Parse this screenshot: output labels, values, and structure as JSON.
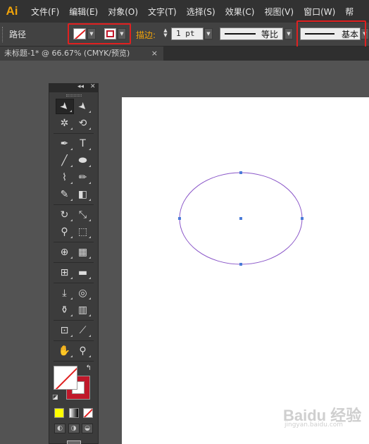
{
  "app": {
    "logo": "Ai"
  },
  "menu": [
    "文件(F)",
    "编辑(E)",
    "对象(O)",
    "文字(T)",
    "选择(S)",
    "效果(C)",
    "视图(V)",
    "窗口(W)",
    "帮"
  ],
  "control_bar": {
    "selection_label": "路径",
    "fill": "none",
    "stroke_color": "#c0182a",
    "stroke_label": "描边:",
    "stroke_weight": "1 pt",
    "variable_width_profile": "等比",
    "brush_definition": "基本"
  },
  "document_tab": {
    "title": "未标题-1* @ 66.67% (CMYK/预览)",
    "close": "×"
  },
  "tool_panel": {
    "collapse_glyph": "◂◂",
    "close_glyph": "✕",
    "rows": [
      [
        {
          "name": "selection-tool-icon",
          "glyph": "➤",
          "active": true
        },
        {
          "name": "direct-selection-tool-icon",
          "glyph": "➤"
        }
      ],
      [
        {
          "name": "magic-wand-tool-icon",
          "glyph": "✲"
        },
        {
          "name": "lasso-tool-icon",
          "glyph": "⟲"
        }
      ],
      [
        {
          "name": "pen-tool-icon",
          "glyph": "✒"
        },
        {
          "name": "type-tool-icon",
          "glyph": "T"
        }
      ],
      [
        {
          "name": "line-segment-tool-icon",
          "glyph": "╱"
        },
        {
          "name": "ellipse-tool-icon",
          "glyph": "⬬"
        }
      ],
      [
        {
          "name": "paintbrush-tool-icon",
          "glyph": "⌇"
        },
        {
          "name": "pencil-tool-icon",
          "glyph": "✏"
        }
      ],
      [
        {
          "name": "blob-brush-tool-icon",
          "glyph": "✎"
        },
        {
          "name": "eraser-tool-icon",
          "glyph": "◧"
        }
      ],
      [
        {
          "name": "rotate-tool-icon",
          "glyph": "↻"
        },
        {
          "name": "scale-tool-icon",
          "glyph": "⤡"
        }
      ],
      [
        {
          "name": "width-tool-icon",
          "glyph": "⚲"
        },
        {
          "name": "free-transform-tool-icon",
          "glyph": "⬚"
        }
      ],
      [
        {
          "name": "shape-builder-tool-icon",
          "glyph": "⊕"
        },
        {
          "name": "perspective-grid-tool-icon",
          "glyph": "▦"
        }
      ],
      [
        {
          "name": "mesh-tool-icon",
          "glyph": "⊞"
        },
        {
          "name": "gradient-tool-icon",
          "glyph": "▬"
        }
      ],
      [
        {
          "name": "eyedropper-tool-icon",
          "glyph": "⤓"
        },
        {
          "name": "blend-tool-icon",
          "glyph": "◎"
        }
      ],
      [
        {
          "name": "symbol-sprayer-tool-icon",
          "glyph": "⚱"
        },
        {
          "name": "column-graph-tool-icon",
          "glyph": "▥"
        }
      ],
      [
        {
          "name": "artboard-tool-icon",
          "glyph": "⊡"
        },
        {
          "name": "slice-tool-icon",
          "glyph": "⟋"
        }
      ],
      [
        {
          "name": "hand-tool-icon",
          "glyph": "✋"
        },
        {
          "name": "zoom-tool-icon",
          "glyph": "⚲"
        }
      ]
    ],
    "swap_glyph": "↰",
    "default_glyph": "◪",
    "color_modes": [
      "#ffff00",
      "gradient",
      "none"
    ],
    "draw_modes": [
      "◐",
      "◑",
      "◒"
    ]
  },
  "canvas": {
    "shape": "ellipse",
    "stroke_color": "#8a56c8",
    "anchor_color": "#4a7bd8"
  },
  "watermark": {
    "main": "Baidu 经验",
    "sub": "jingyan.baidu.com"
  }
}
